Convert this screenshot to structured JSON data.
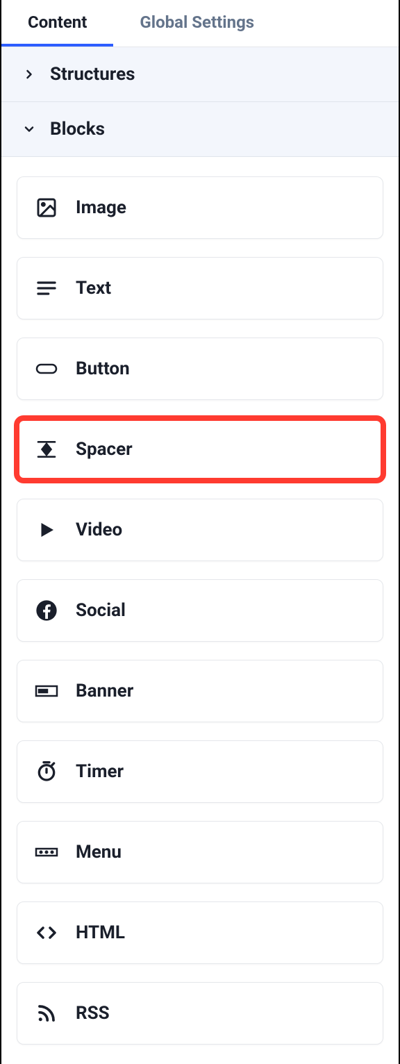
{
  "tabs": {
    "content": "Content",
    "globalSettings": "Global Settings"
  },
  "sections": {
    "structures": "Structures",
    "blocks": "Blocks"
  },
  "highlighted_block": "spacer",
  "blocks": {
    "image": "Image",
    "text": "Text",
    "button": "Button",
    "spacer": "Spacer",
    "video": "Video",
    "social": "Social",
    "banner": "Banner",
    "timer": "Timer",
    "menu": "Menu",
    "html": "HTML",
    "rss": "RSS"
  }
}
